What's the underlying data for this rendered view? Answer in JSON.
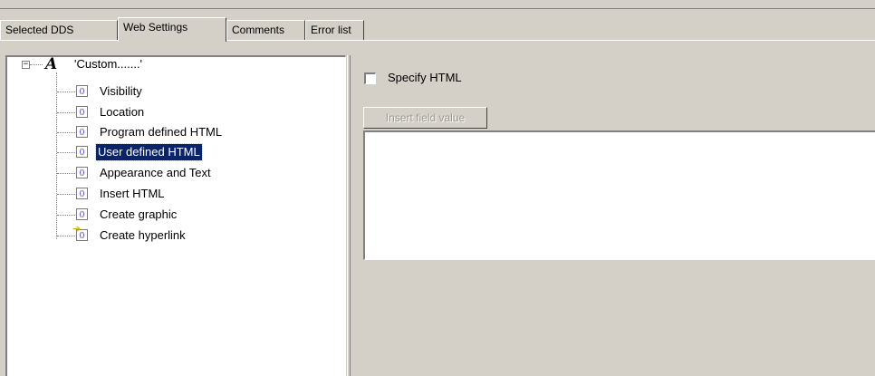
{
  "tabs": [
    {
      "label": "Selected DDS"
    },
    {
      "label": "Web Settings",
      "active": true
    },
    {
      "label": "Comments"
    },
    {
      "label": "Error list"
    }
  ],
  "tree": {
    "root_label": "'Custom.......'",
    "items": [
      {
        "label": "Visibility",
        "icon": "html-node-icon"
      },
      {
        "label": "Location",
        "icon": "html-node-icon"
      },
      {
        "label": "Program defined HTML",
        "icon": "html-node-icon"
      },
      {
        "label": "User defined HTML",
        "icon": "html-node-icon",
        "selected": true
      },
      {
        "label": "Appearance and Text",
        "icon": "html-node-icon"
      },
      {
        "label": "Insert HTML",
        "icon": "html-node-icon"
      },
      {
        "label": "Create graphic",
        "icon": "html-node-icon"
      },
      {
        "label": "Create hyperlink",
        "icon": "hyperlink-node-icon"
      }
    ]
  },
  "specify_html": {
    "label": "Specify HTML",
    "checked": false
  },
  "insert_field_button": {
    "label": "Insert field value",
    "enabled": false
  },
  "html_editor": {
    "value": ""
  }
}
